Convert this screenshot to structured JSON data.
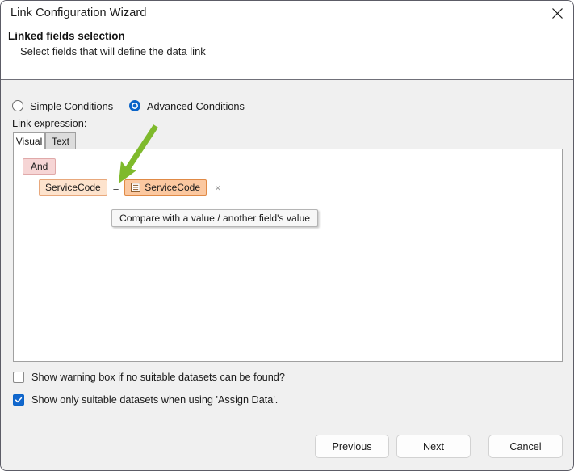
{
  "window": {
    "title": "Link Configuration Wizard",
    "close_icon": "close-icon"
  },
  "header": {
    "heading": "Linked fields selection",
    "subtitle": "Select fields that will define the data link"
  },
  "conditions_mode": {
    "simple_label": "Simple Conditions",
    "advanced_label": "Advanced Conditions",
    "selected": "Advanced Conditions"
  },
  "expression": {
    "section_label": "Link expression:",
    "tabs": [
      {
        "label": "Visual",
        "active": true
      },
      {
        "label": "Text",
        "active": false
      }
    ],
    "logical_operator": "And",
    "condition": {
      "left_field": "ServiceCode",
      "operator": "=",
      "right_field": "ServiceCode",
      "right_field_icon": "table-field-icon",
      "remove_icon": "×"
    },
    "tooltip": "Compare with a value / another field's value",
    "annotation": {
      "type": "arrow",
      "color": "#7fba2c",
      "direction": "down-left"
    }
  },
  "options": [
    {
      "label": "Show warning box if no suitable datasets can be found?",
      "checked": false
    },
    {
      "label": "Show only suitable datasets when using 'Assign Data'.",
      "checked": true
    }
  ],
  "footer": {
    "previous_label": "Previous",
    "next_label": "Next",
    "cancel_label": "Cancel"
  },
  "colors": {
    "accent": "#0a64c8",
    "and_chip_bg": "#f6d5d5",
    "field_chip_bg": "#fde3cd",
    "field_chip_strong_bg": "#fbc8a0",
    "annotation_green": "#7fba2c"
  }
}
